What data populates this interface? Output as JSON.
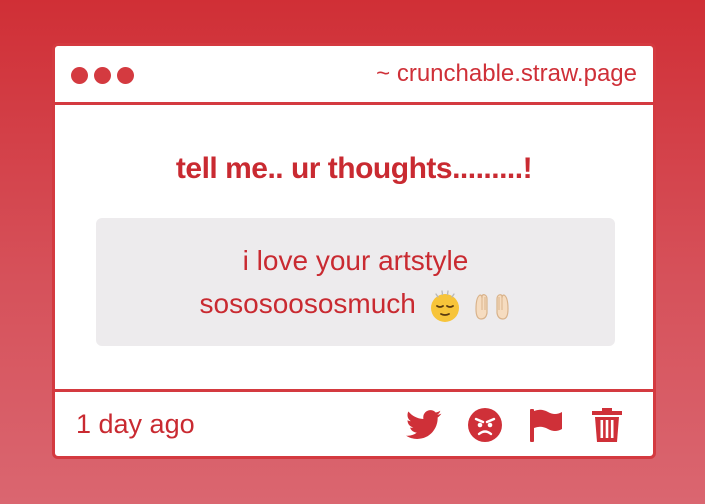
{
  "window": {
    "url": "~ crunchable.straw.page"
  },
  "question": {
    "prompt": "tell me.. ur thoughts.........!",
    "answer_line1": "i love your artstyle",
    "answer_line2": "sososoososmuch"
  },
  "footer": {
    "timestamp": "1 day ago",
    "actions": [
      {
        "icon": "twitter-bird-icon"
      },
      {
        "icon": "angry-face-icon"
      },
      {
        "icon": "flag-icon"
      },
      {
        "icon": "trash-icon"
      }
    ]
  },
  "colors": {
    "accent": "#d43a40",
    "text": "#c92a31",
    "answer_bg": "#edebed"
  }
}
